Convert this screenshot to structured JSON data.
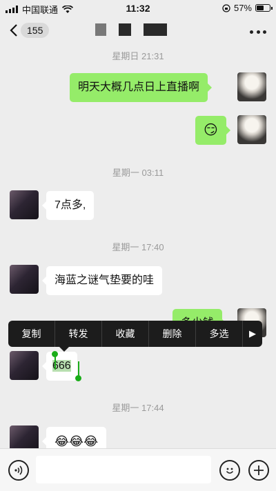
{
  "status_bar": {
    "carrier": "中国联通",
    "time": "11:32",
    "battery": "57%",
    "battery_level": 0.57
  },
  "nav": {
    "back_count": "155"
  },
  "messages": {
    "t1": "星期日 21:31",
    "m1": "明天大概几点日上直播啊",
    "m2": "😏",
    "t2": "星期一 03:11",
    "m3": "7点多,",
    "t3": "星期一 17:40",
    "m4": "海蓝之谜气垫要的哇",
    "m5": "多少钱",
    "m6": "666",
    "t4": "星期一 17:44",
    "m7": "😂😂😂"
  },
  "context_menu": {
    "copy": "复制",
    "forward": "转发",
    "favorite": "收藏",
    "delete": "删除",
    "multi_select": "多选",
    "more": "▶"
  },
  "colors": {
    "self_bubble": "#95ec69",
    "other_bubble": "#ffffff",
    "selection": "#1aad19"
  },
  "icons": [
    "back-chevron-icon",
    "more-dots-icon",
    "voice-icon",
    "emoji-icon",
    "add-icon"
  ]
}
